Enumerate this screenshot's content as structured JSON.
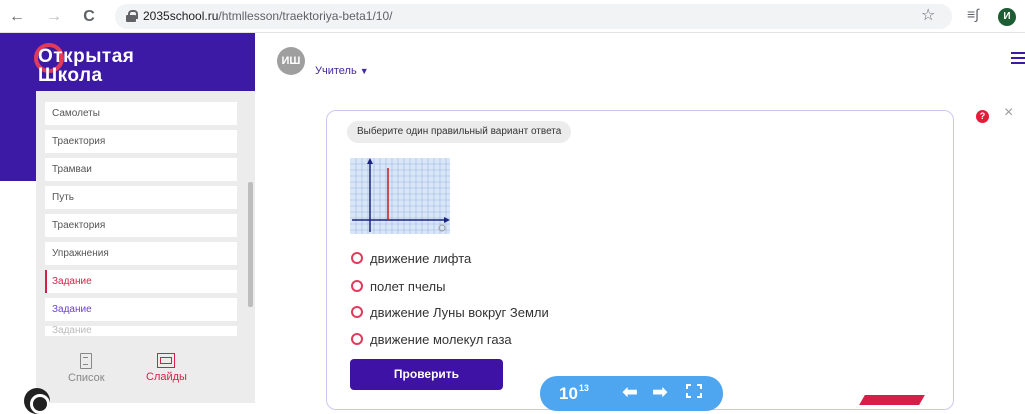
{
  "browser": {
    "back": "←",
    "forward": "→",
    "reload": "C",
    "url_host": "2035school.ru",
    "url_path": "/htmllesson/traektoriya-beta1/10/",
    "bookmark": "☆",
    "reading_list": "≡∫",
    "profile_initial": "И"
  },
  "header": {
    "logo_line1": "Открытая",
    "logo_line2": "Школа",
    "avatar_initials": "ИШ",
    "role": "Учитель",
    "role_caret": "▼"
  },
  "sidebar": {
    "items": [
      {
        "label": "Самолеты"
      },
      {
        "label": "Траектория"
      },
      {
        "label": "Трамваи"
      },
      {
        "label": "Путь"
      },
      {
        "label": "Траектория"
      },
      {
        "label": "Упражнения"
      },
      {
        "label": "Задание",
        "active": true
      },
      {
        "label": "Задание"
      },
      {
        "label": "Задание"
      }
    ],
    "tabs": {
      "list": "Список",
      "slides": "Слайды"
    }
  },
  "task": {
    "instruction": "Выберите один правильный вариант ответа",
    "options": [
      "движение лифта",
      "полет пчелы",
      "движение Луны вокруг Земли",
      "движение молекул газа"
    ],
    "check_button": "Проверить"
  },
  "pager": {
    "current": "10",
    "total": "13"
  },
  "colors": {
    "brand_purple": "#3d1aa6",
    "accent_red": "#e23a5d",
    "pager_blue": "#4ea5f0"
  },
  "icons": [
    "back-icon",
    "forward-icon",
    "reload-icon",
    "lock-icon",
    "star-icon",
    "reading-list-icon",
    "help-icon",
    "close-icon",
    "list-icon",
    "slides-icon",
    "prev-arrow-icon",
    "next-arrow-icon",
    "fullscreen-icon",
    "menu-icon"
  ]
}
